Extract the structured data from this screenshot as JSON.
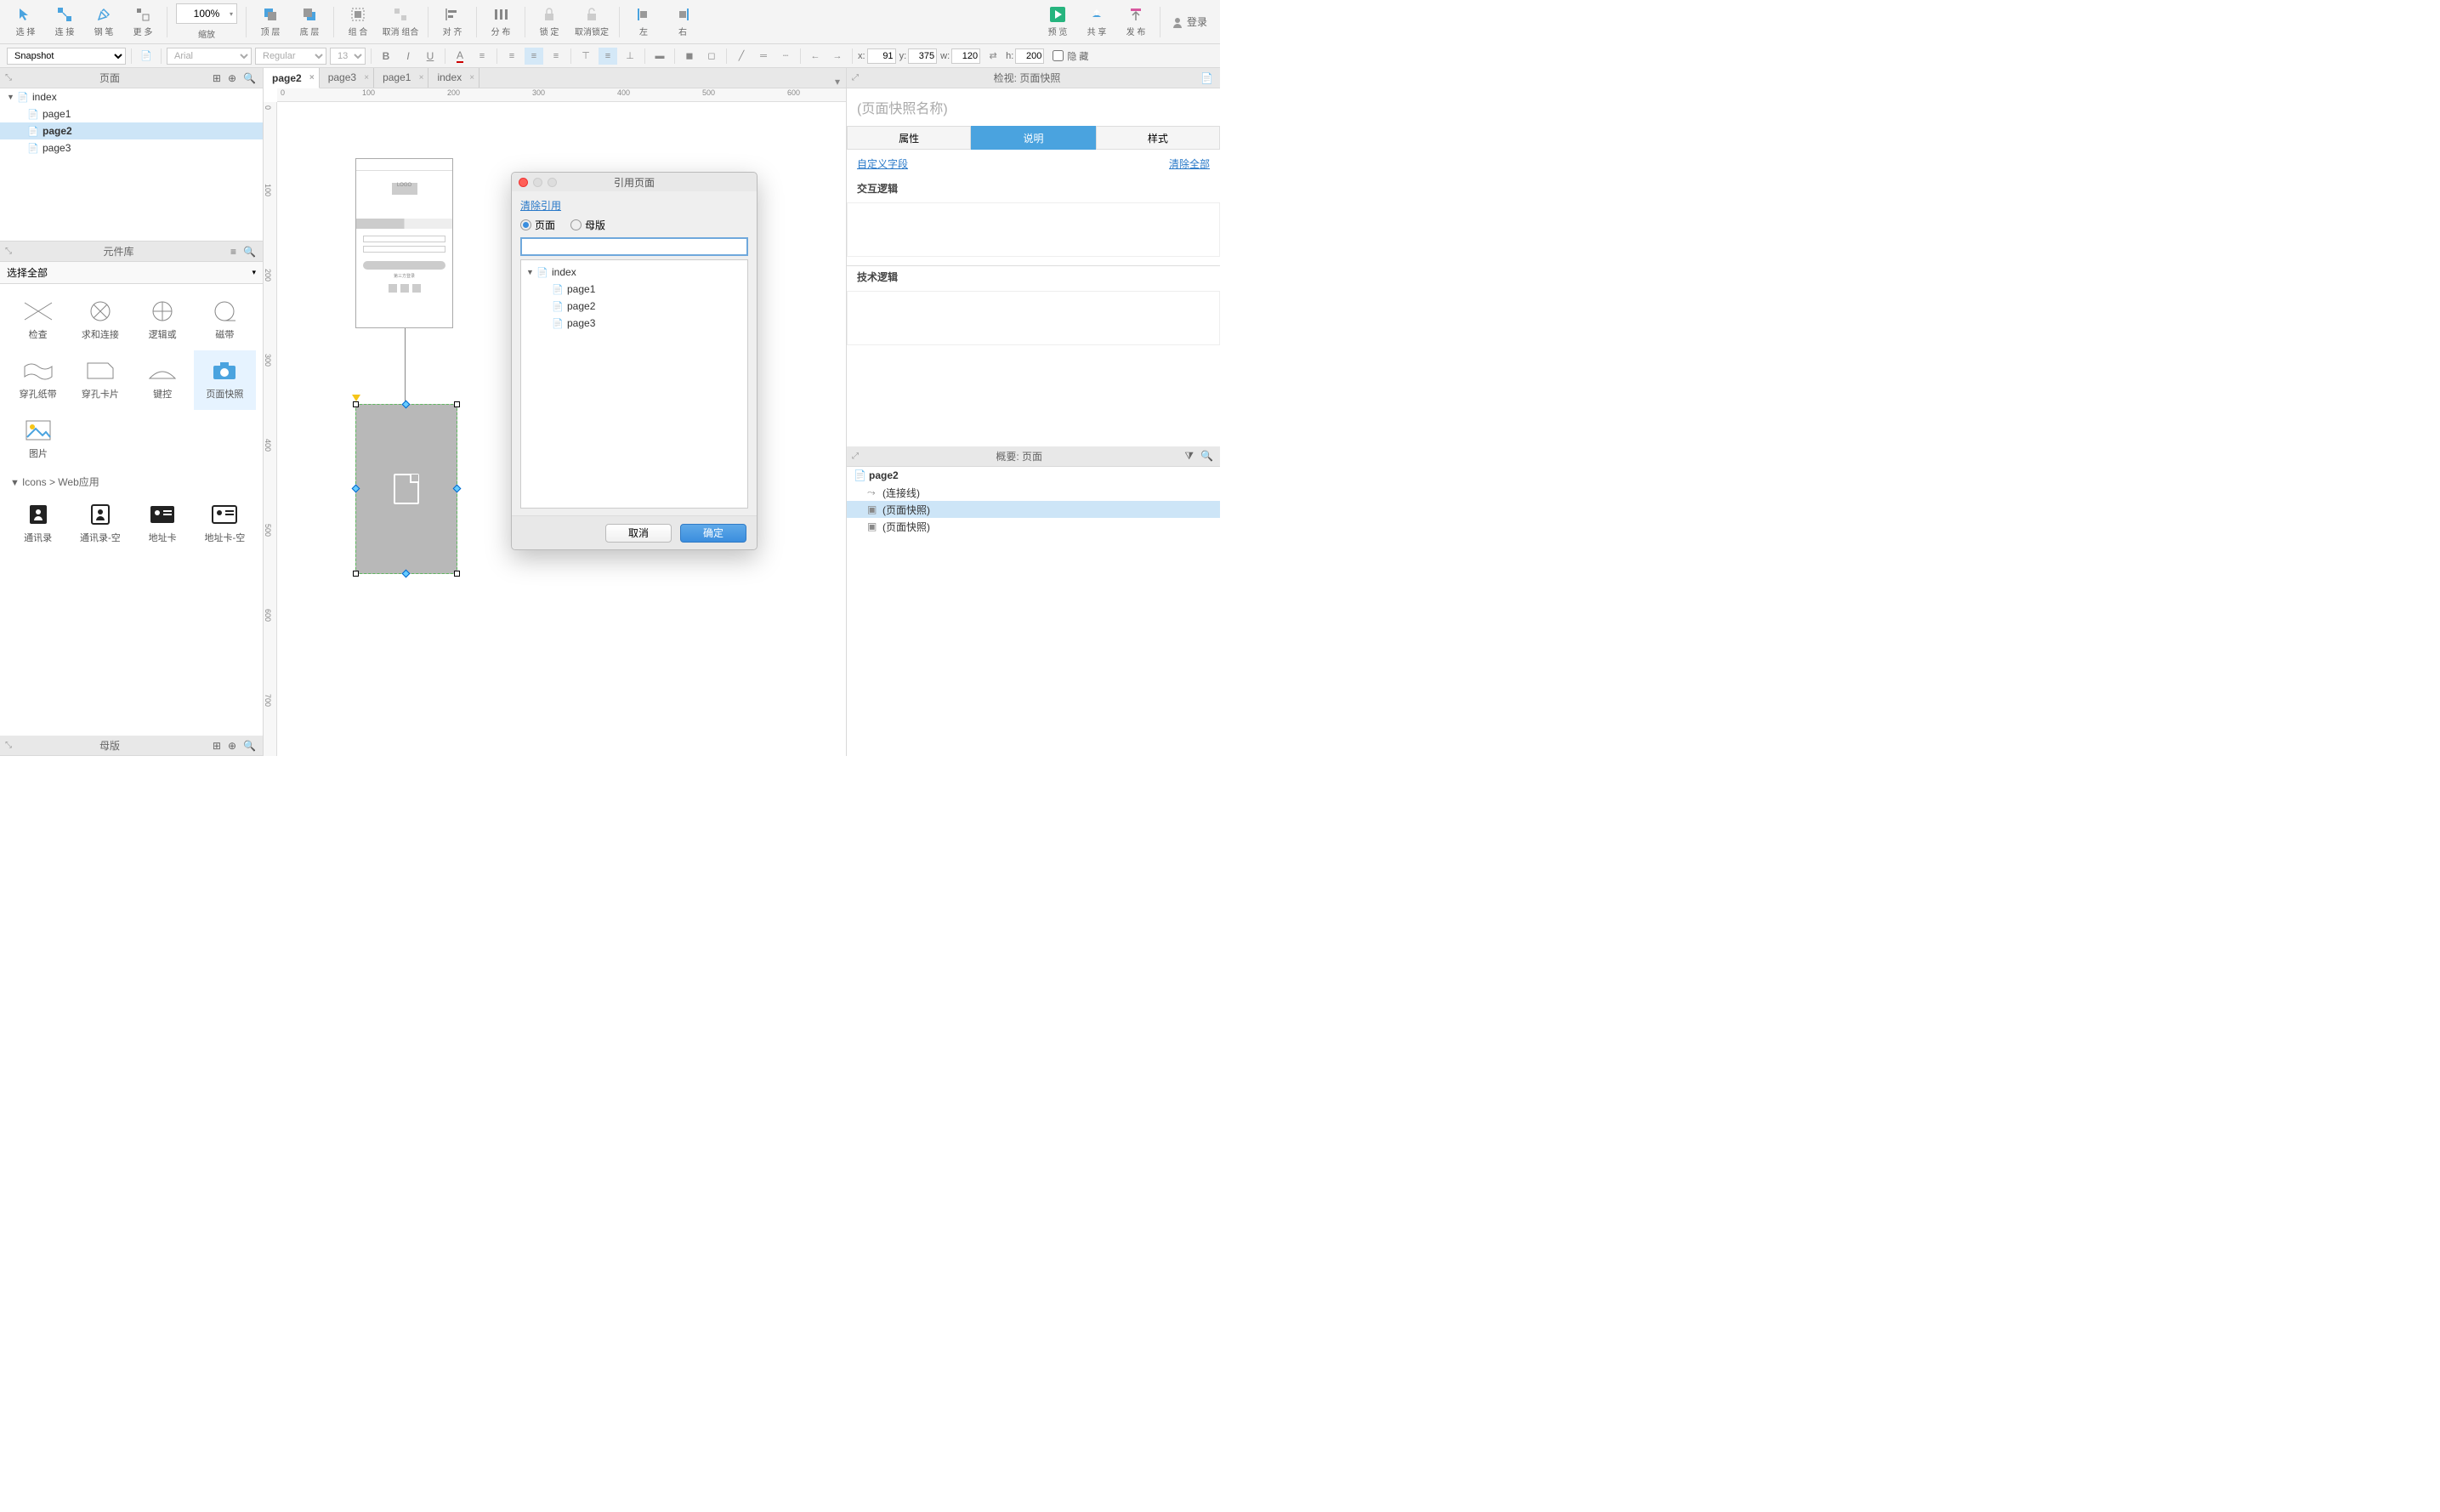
{
  "toolbar": {
    "select": "选 择",
    "connect": "连 接",
    "pen": "钢 笔",
    "more": "更 多",
    "zoom_label": "缩放",
    "zoom_value": "100%",
    "front": "顶 层",
    "back": "底 层",
    "group": "组 合",
    "ungroup": "取消 组合",
    "align": "对 齐",
    "distribute": "分 布",
    "lock": "锁 定",
    "unlock": "取消锁定",
    "alignLeft": "左",
    "alignRight": "右",
    "preview": "预 览",
    "share": "共 享",
    "publish": "发 布",
    "login": "登录"
  },
  "format": {
    "widget_type": "Snapshot",
    "font": "Arial",
    "weight": "Regular",
    "size": "13",
    "x_label": "x:",
    "x": "91",
    "y_label": "y:",
    "y": "375",
    "w_label": "w:",
    "w": "120",
    "h_label": "h:",
    "h": "200",
    "hidden": "隐 藏"
  },
  "panels": {
    "pages_title": "页面",
    "library_title": "元件库",
    "library_select": "选择全部",
    "library_category": "Icons > Web应用",
    "masters_title": "母版",
    "inspector_title_prefix": "检视:",
    "outline_title_prefix": "概要:",
    "outline_scope": "页面"
  },
  "pages_tree": {
    "root": "index",
    "children": [
      "page1",
      "page2",
      "page3"
    ],
    "selected": "page2"
  },
  "library_items": {
    "row1": [
      "检查",
      "求和连接",
      "逻辑或",
      "磁带"
    ],
    "row2": [
      "穿孔纸带",
      "穿孔卡片",
      "键控",
      "页面快照"
    ],
    "row3": [
      "图片"
    ],
    "row4": [
      "通讯录",
      "通讯录-空",
      "地址卡",
      "地址卡-空"
    ]
  },
  "tabs": [
    "page2",
    "page3",
    "page1",
    "index"
  ],
  "active_tab": "page2",
  "ruler_h": [
    "0",
    "100",
    "200",
    "300",
    "400",
    "500",
    "600"
  ],
  "ruler_v": [
    "0",
    "100",
    "200",
    "300",
    "400",
    "500",
    "600",
    "700"
  ],
  "inspector": {
    "snapshot_name_placeholder": "(页面快照名称)",
    "snapshot_type": "页面快照",
    "tabs": [
      "属性",
      "说明",
      "样式"
    ],
    "active_tab": "说明",
    "custom_fields": "自定义字段",
    "clear_all": "清除全部",
    "section1": "交互逻辑",
    "section2": "技术逻辑"
  },
  "outline": {
    "root": "page2",
    "items": [
      "(连接线)",
      "(页面快照)",
      "(页面快照)"
    ],
    "selected_index": 1
  },
  "dialog": {
    "title": "引用页面",
    "clear_ref": "清除引用",
    "opt_page": "页面",
    "opt_master": "母版",
    "search_value": "",
    "tree_root": "index",
    "tree_children": [
      "page1",
      "page2",
      "page3"
    ],
    "cancel": "取消",
    "ok": "确定"
  }
}
